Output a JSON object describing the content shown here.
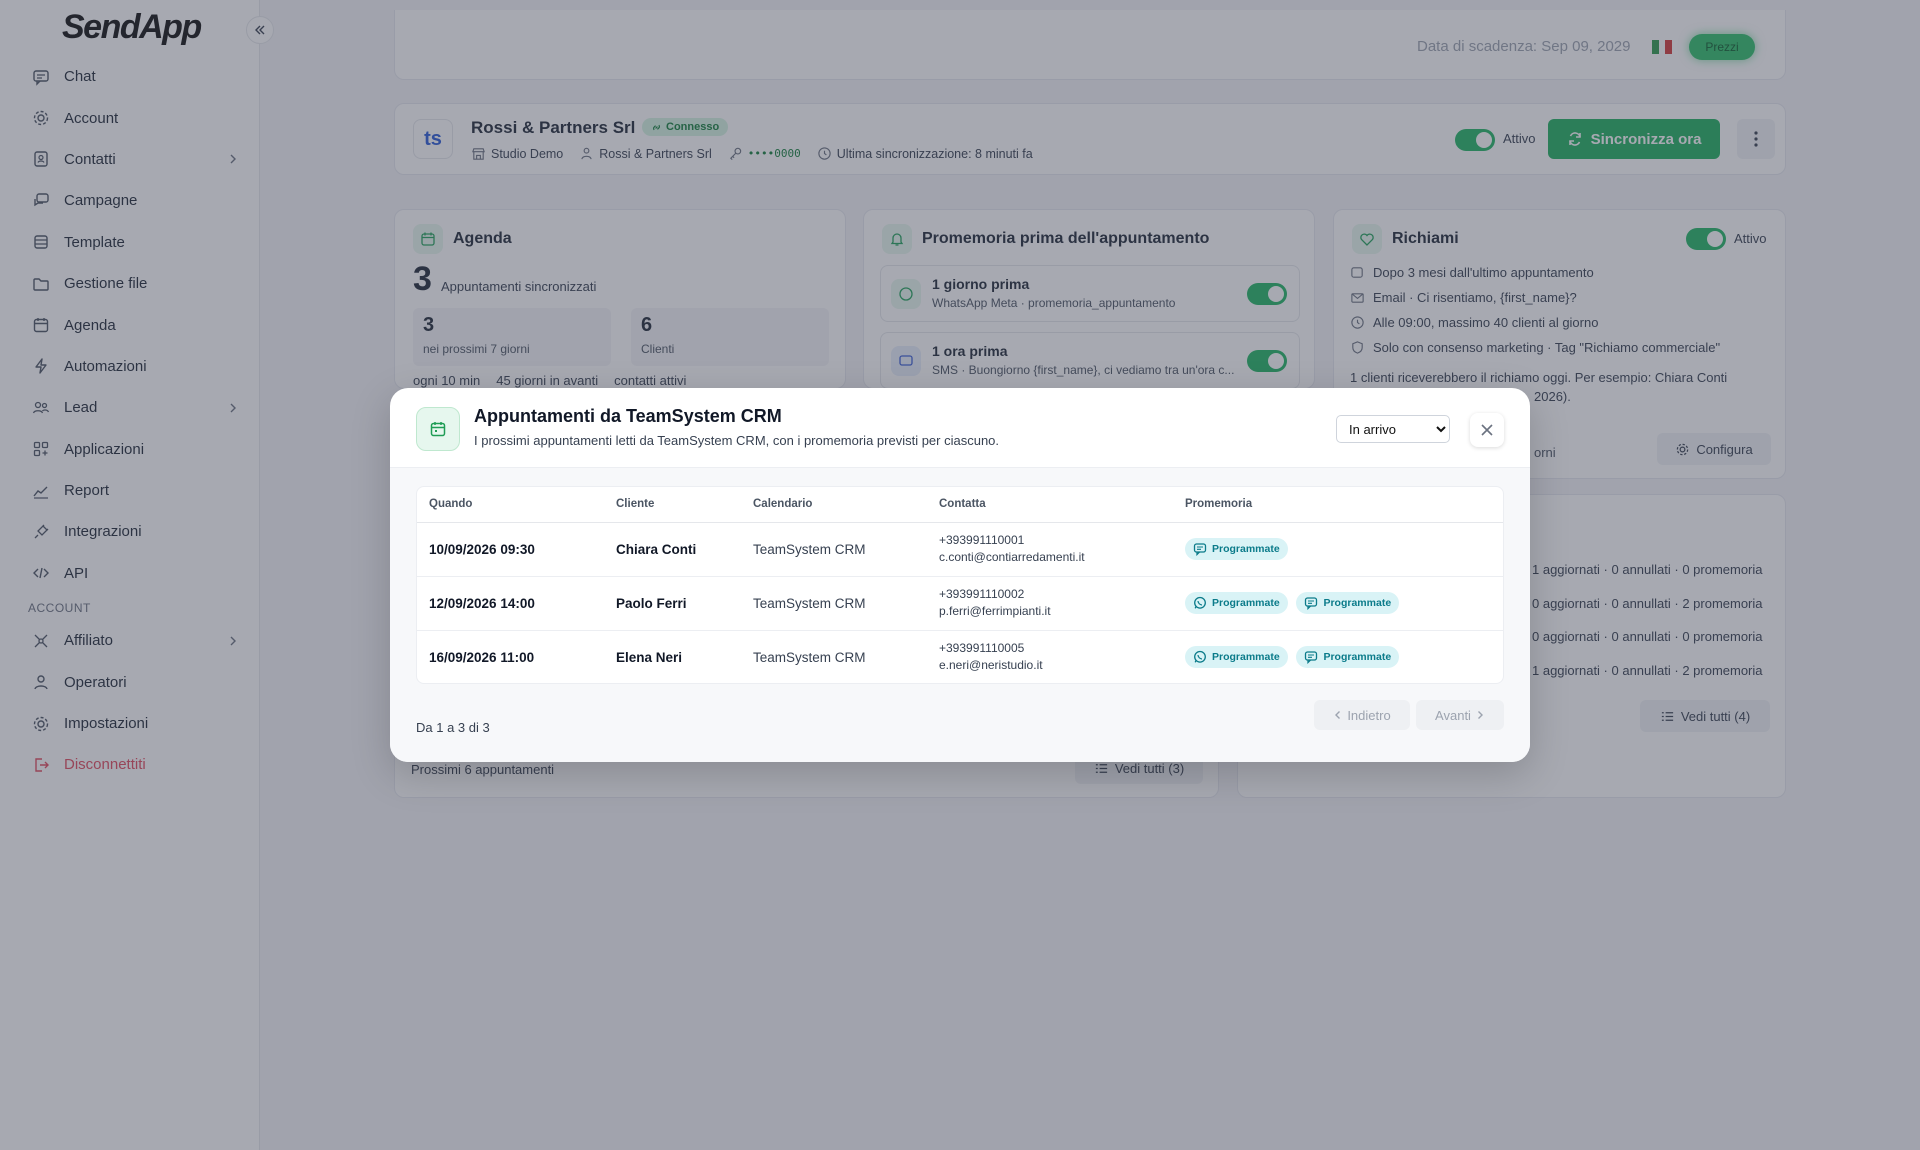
{
  "sidebar": {
    "logo": "SendApp",
    "items": [
      {
        "label": "Chat"
      },
      {
        "label": "Account"
      },
      {
        "label": "Contatti"
      },
      {
        "label": "Campagne"
      },
      {
        "label": "Template"
      },
      {
        "label": "Gestione file"
      },
      {
        "label": "Agenda"
      },
      {
        "label": "Automazioni"
      },
      {
        "label": "Lead"
      },
      {
        "label": "Applicazioni"
      },
      {
        "label": "Report"
      },
      {
        "label": "Integrazioni"
      },
      {
        "label": "API"
      }
    ],
    "section_label": "ACCOUNT",
    "account_items": [
      {
        "label": "Affiliato"
      },
      {
        "label": "Operatori"
      },
      {
        "label": "Impostazioni"
      },
      {
        "label": "Disconnettiti"
      }
    ]
  },
  "topbar": {
    "expiry": "Data di scadenza: Sep 09, 2029",
    "prices_button": "Prezzi"
  },
  "connection": {
    "logo_text": "ts",
    "name": "Rossi & Partners Srl",
    "status_badge": "Connesso",
    "workspace": "Studio Demo",
    "account": "Rossi & Partners Srl",
    "key_mask": "••••0000",
    "last_sync": "Ultima sincronizzazione: 8 minuti fa",
    "toggle_label": "Attivo",
    "sync_button": "Sincronizza ora"
  },
  "agenda_card": {
    "title": "Agenda",
    "big_count": "3",
    "big_label": "Appuntamenti sincronizzati",
    "stat1_value": "3",
    "stat1_label": "nei prossimi 7 giorni",
    "stat2_value": "6",
    "stat2_label": "Clienti",
    "meta1": "ogni 10 min",
    "meta2": "45 giorni in avanti",
    "meta3": "contatti attivi",
    "footer": "Prossimi 6 appuntamenti",
    "see_all": "Vedi tutti (3)"
  },
  "reminder_card": {
    "title": "Promemoria prima dell'appuntamento",
    "item1_title": "1 giorno prima",
    "item1_sub": "WhatsApp Meta · promemoria_appuntamento",
    "item2_title": "1 ora prima",
    "item2_sub": "SMS · Buongiorno {first_name}, ci vediamo tra un'ora c..."
  },
  "recall_card": {
    "title": "Richiami",
    "toggle_label": "Attivo",
    "line1": "Dopo 3 mesi dall'ultimo appuntamento",
    "line2": "Email · Ci risentiamo, {first_name}?",
    "line3": "Alle 09:00, massimo 40 clienti al giorno",
    "line4": "Solo con consenso marketing · Tag \"Richiamo commerciale\"",
    "note_line1": "1 clienti riceverebbero il richiamo oggi. Per esempio: Chiara Conti",
    "note_line2": "2026).",
    "partial": "orni",
    "configure": "Configura"
  },
  "sync_log": {
    "rows": [
      "1 aggiornati · 0 annullati · 0 promemoria",
      "0 aggiornati · 0 annullati · 2 promemoria",
      "0 aggiornati · 0 annullati · 0 promemoria",
      "1 aggiornati · 0 annullati · 2 promemoria"
    ],
    "see_all": "Vedi tutti (4)"
  },
  "modal": {
    "title": "Appuntamenti da TeamSystem CRM",
    "subtitle": "I prossimi appuntamenti letti da TeamSystem CRM, con i promemoria previsti per ciascuno.",
    "filter_selected": "In arrivo",
    "columns": {
      "when": "Quando",
      "client": "Cliente",
      "calendar": "Calendario",
      "contact": "Contatta",
      "reminder": "Promemoria"
    },
    "rows": [
      {
        "when": "10/09/2026 09:30",
        "client": "Chiara Conti",
        "calendar": "TeamSystem CRM",
        "phone": "+393991110001",
        "email": "c.conti@contiarredamenti.it",
        "chip1": "Programmate",
        "chip2": ""
      },
      {
        "when": "12/09/2026 14:00",
        "client": "Paolo Ferri",
        "calendar": "TeamSystem CRM",
        "phone": "+393991110002",
        "email": "p.ferri@ferrimpianti.it",
        "chip1": "Programmate",
        "chip2": "Programmate"
      },
      {
        "when": "16/09/2026 11:00",
        "client": "Elena Neri",
        "calendar": "TeamSystem CRM",
        "phone": "+393991110005",
        "email": "e.neri@neristudio.it",
        "chip1": "Programmate",
        "chip2": "Programmate"
      }
    ],
    "footer": "Da 1 a 3 di 3",
    "prev": "Indietro",
    "next": "Avanti"
  }
}
